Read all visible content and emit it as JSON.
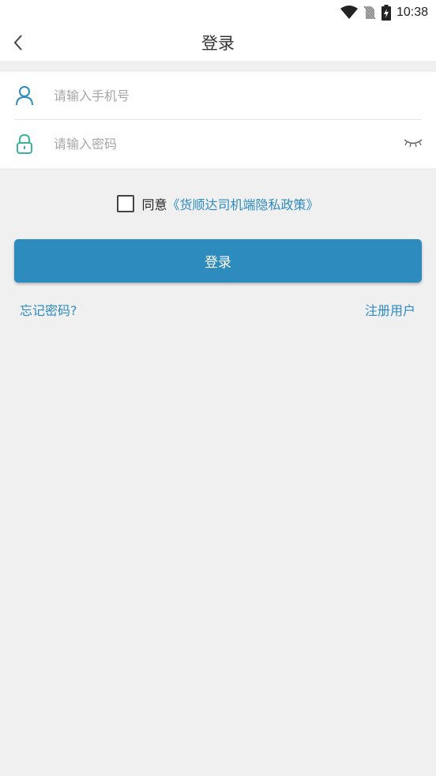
{
  "statusbar": {
    "time": "10:38",
    "icons": [
      "wifi-icon",
      "no-sim-icon",
      "battery-charging-icon"
    ]
  },
  "appbar": {
    "back_icon": "chevron-left-icon",
    "title": "登录"
  },
  "form": {
    "phone": {
      "icon": "user-icon",
      "placeholder": "请输入手机号",
      "value": ""
    },
    "password": {
      "icon": "lock-icon",
      "placeholder": "请输入密码",
      "value": "",
      "toggle_icon": "eye-closed-icon"
    }
  },
  "agreement": {
    "checked": false,
    "prefix": "同意",
    "policy_link": "《货顺达司机端隐私政策》"
  },
  "login_button": {
    "label": "登录"
  },
  "links": {
    "forgot": "忘记密码?",
    "register": "注册用户"
  },
  "colors": {
    "accent": "#2d8bbd",
    "link": "#2d8bc0",
    "lock_icon": "#3cb39a",
    "background": "#f0f0f0"
  }
}
